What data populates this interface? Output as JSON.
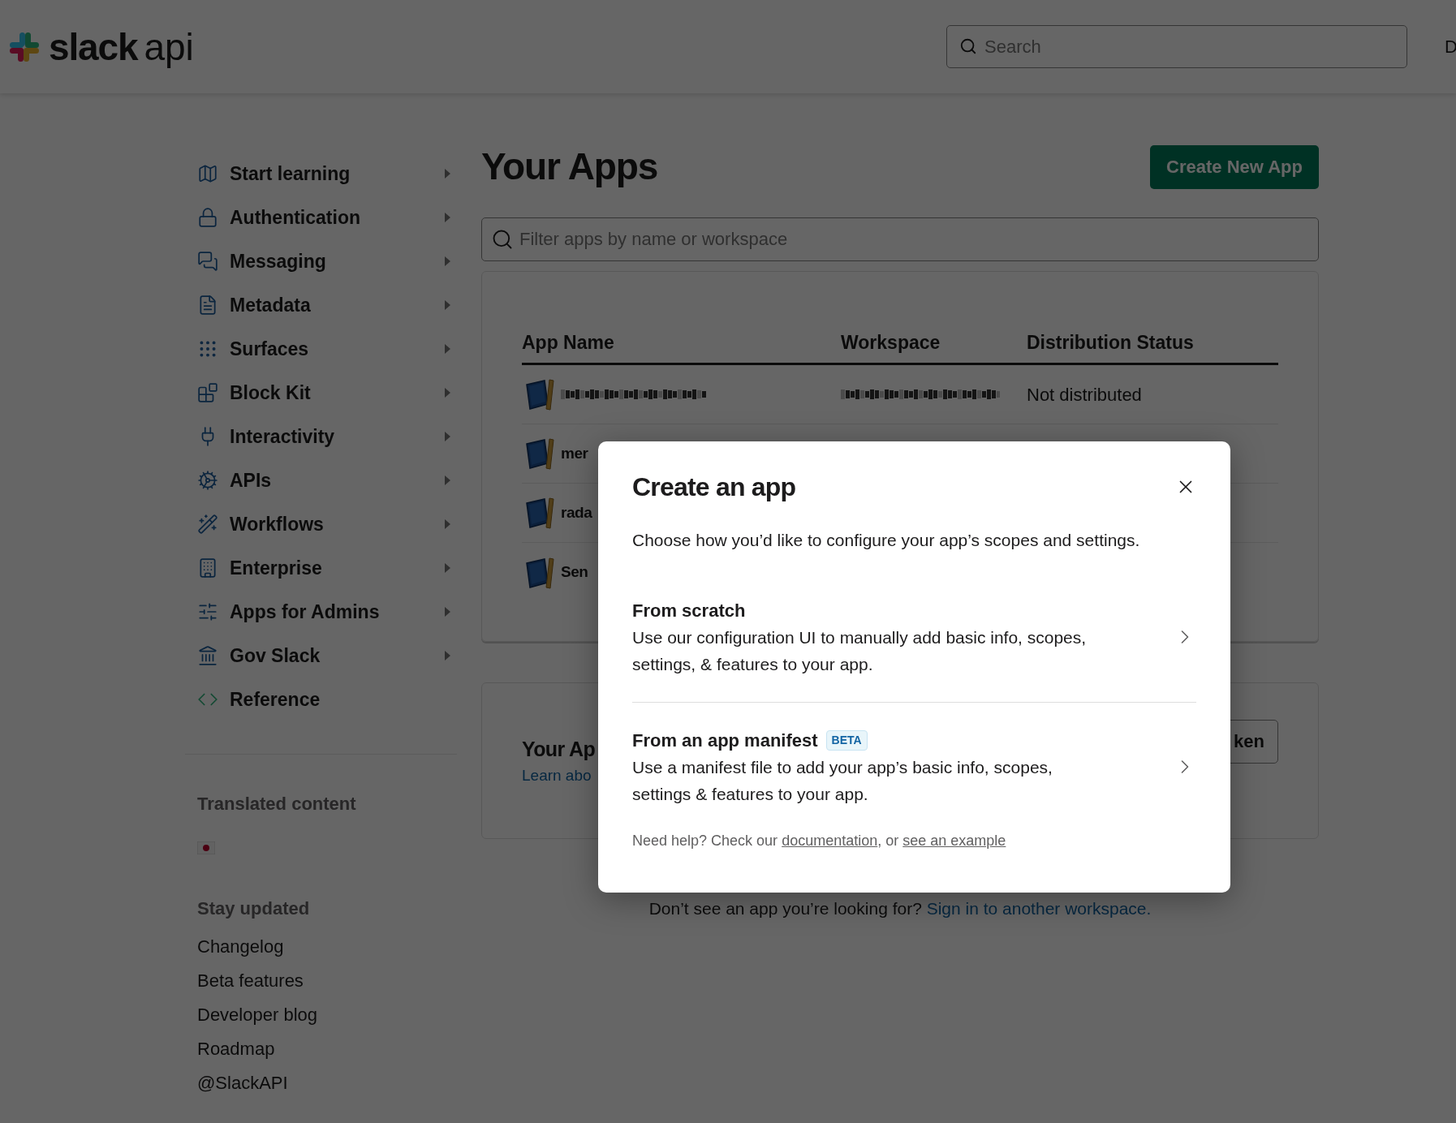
{
  "header": {
    "logo": {
      "word": "slack",
      "suffix": "api"
    },
    "search": {
      "placeholder": "Search"
    },
    "edge_text": "D"
  },
  "sidebar": {
    "items": [
      {
        "label": "Start learning",
        "has_submenu": true
      },
      {
        "label": "Authentication",
        "has_submenu": true
      },
      {
        "label": "Messaging",
        "has_submenu": true
      },
      {
        "label": "Metadata",
        "has_submenu": true
      },
      {
        "label": "Surfaces",
        "has_submenu": true
      },
      {
        "label": "Block Kit",
        "has_submenu": true
      },
      {
        "label": "Interactivity",
        "has_submenu": true
      },
      {
        "label": "APIs",
        "has_submenu": true
      },
      {
        "label": "Workflows",
        "has_submenu": true
      },
      {
        "label": "Enterprise",
        "has_submenu": true
      },
      {
        "label": "Apps for Admins",
        "has_submenu": true
      },
      {
        "label": "Gov Slack",
        "has_submenu": true
      },
      {
        "label": "Reference",
        "has_submenu": false
      }
    ],
    "translated": {
      "title": "Translated content"
    },
    "stay_updated": {
      "title": "Stay updated",
      "links": [
        "Changelog",
        "Beta features",
        "Developer blog",
        "Roadmap",
        "@SlackAPI"
      ]
    }
  },
  "main": {
    "title": "Your Apps",
    "create_button": "Create New App",
    "filter": {
      "placeholder": "Filter apps by name or workspace"
    },
    "table": {
      "columns": [
        "App Name",
        "Workspace",
        "Distribution Status"
      ],
      "rows": [
        {
          "kind": "redacted",
          "status": "Not distributed"
        },
        {
          "kind": "app",
          "app_name": "mer"
        },
        {
          "kind": "app",
          "app_name": "rada"
        },
        {
          "kind": "app",
          "app_name": "Sen"
        }
      ]
    },
    "tokens_card": {
      "title": "Your Ap",
      "link": "Learn abo",
      "button": "ken"
    },
    "footer_note": {
      "text": "Don’t see an app you’re looking for?",
      "link": "Sign in to another workspace."
    }
  },
  "modal": {
    "title": "Create an app",
    "description": "Choose how you’d like to configure your app’s scopes and settings.",
    "options": [
      {
        "title": "From scratch",
        "description": "Use our configuration UI to manually add basic info, scopes, settings, & features to your app."
      },
      {
        "title": "From an app manifest",
        "badge": "BETA",
        "description": "Use a manifest file to add your app’s basic info, scopes, settings & features to your app."
      }
    ],
    "help": {
      "lead": "Need help? Check our",
      "link_1": "documentation",
      "middle": ", or",
      "link_2": "see an example"
    }
  }
}
